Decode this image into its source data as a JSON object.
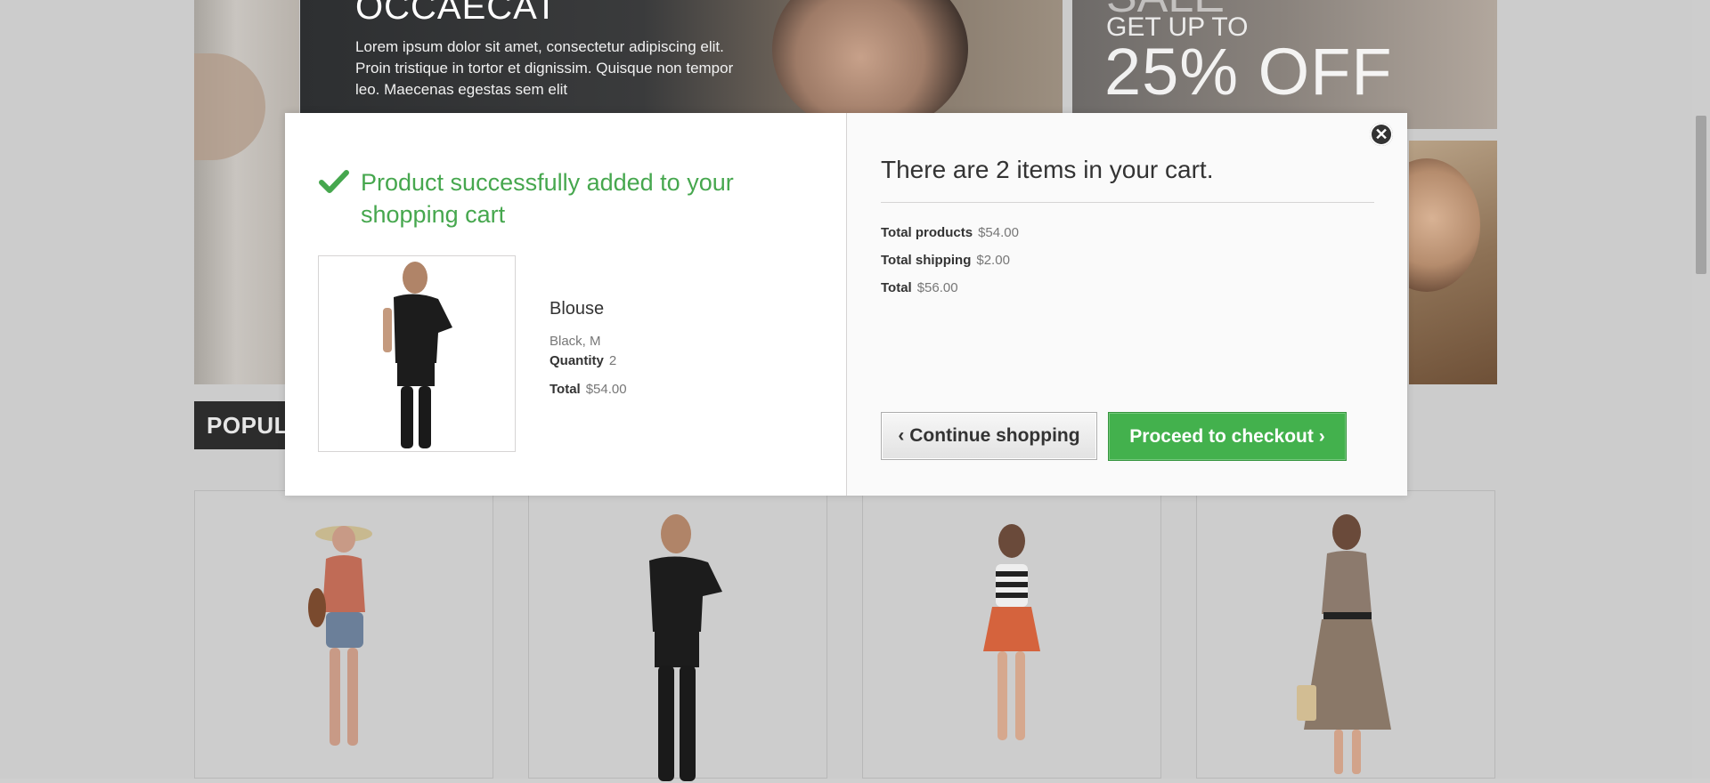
{
  "hero": {
    "title": "OCCAECAT",
    "text": "Lorem ipsum dolor sit amet, consectetur adipiscing elit. Proin tristique in tortor et dignissim. Quisque non tempor leo. Maecenas egestas sem elit",
    "sale_ghost": "SALE",
    "sale_getup": "GET UP TO",
    "sale_pct": "25% OFF"
  },
  "section": {
    "popular_tab": "POPULAR"
  },
  "modal": {
    "close_icon": "close-icon",
    "success_message": "Product successfully added to your shopping cart",
    "product": {
      "name": "Blouse",
      "attributes": "Black, M",
      "quantity_label": "Quantity",
      "quantity": "2",
      "total_label": "Total",
      "total": "$54.00"
    },
    "cart": {
      "title": "There are 2 items in your cart.",
      "total_products_label": "Total products",
      "total_products": "$54.00",
      "total_shipping_label": "Total shipping",
      "total_shipping": "$2.00",
      "total_label": "Total",
      "total": "$56.00"
    },
    "continue_label": "Continue shopping",
    "checkout_label": "Proceed to checkout"
  },
  "colors": {
    "success": "#46a74e",
    "checkout_button": "#43b14d",
    "overlay": "#cccccc"
  }
}
